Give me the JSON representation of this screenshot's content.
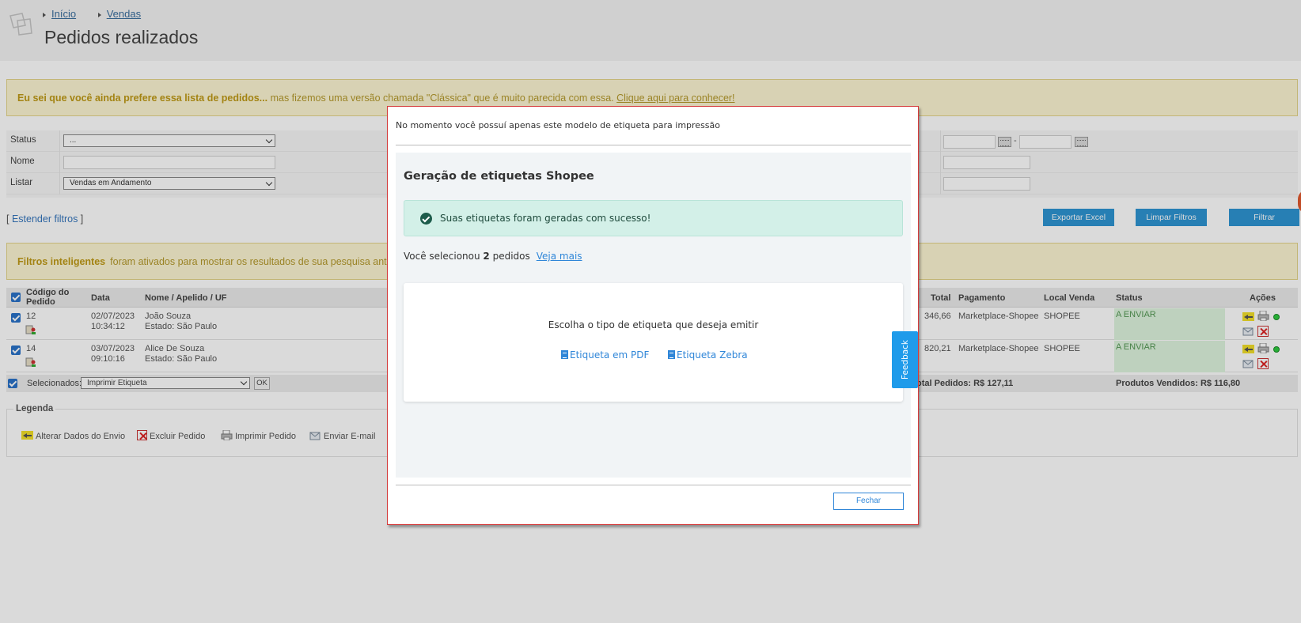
{
  "breadcrumb": [
    "Início",
    "Vendas"
  ],
  "page_title": "Pedidos realizados",
  "banner": {
    "bold": "Eu sei que você ainda prefere essa lista de pedidos...",
    "text": " mas fizemos uma versão chamada \"Clássica\" que é muito parecida com essa. ",
    "link": "Clique aqui para conhecer!"
  },
  "filters": {
    "status_label": "Status",
    "status_value": "...",
    "nome_label": "Nome",
    "listar_label": "Listar",
    "listar_value": "Vendas em Andamento",
    "date_separator": "-"
  },
  "extend_filters": {
    "open": "[ ",
    "link": "Estender filtros",
    "close": " ]"
  },
  "buttons": {
    "export": "Exportar Excel",
    "clear": "Limpar Filtros",
    "filter": "Filtrar"
  },
  "smart_filters": {
    "bold": "Filtros inteligentes",
    "text": "foram ativados para mostrar os resultados de sua pesquisa ant"
  },
  "table": {
    "headers": {
      "code": "Código do Pedido",
      "date": "Data",
      "name": "Nome / Apelido / UF",
      "total": "Total",
      "payment": "Pagamento",
      "local": "Local Venda",
      "status": "Status",
      "actions": "Ações"
    },
    "rows": [
      {
        "code": "12",
        "date": "02/07/2023",
        "time": "10:34:12",
        "name": "João Souza",
        "state": "Estado: São Paulo",
        "total": "346,66",
        "payment": "Marketplace-Shopee",
        "local": "SHOPEE",
        "status": "A ENVIAR"
      },
      {
        "code": "14",
        "date": "03/07/2023",
        "time": "09:10:16",
        "name": "Alice De Souza",
        "state": "Estado: São Paulo",
        "total": "820,21",
        "payment": "Marketplace-Shopee",
        "local": "SHOPEE",
        "status": "A ENVIAR"
      }
    ],
    "footer": {
      "selected_label": "Selecionados:",
      "action_value": "Imprimir Etiqueta",
      "ok": "OK",
      "total_pedidos": "otal Pedidos: R$ 127,11",
      "produtos_vendidos": "Produtos Vendidos: R$ 116,80"
    }
  },
  "legend": {
    "title": "Legenda",
    "items": [
      "Alterar Dados do Envio",
      "Excluir Pedido",
      "Imprimir Pedido",
      "Enviar E-mail"
    ]
  },
  "modal": {
    "top_text": "No momento você possuí apenas este modelo de etiqueta para impressão",
    "title": "Geração de etiquetas Shopee",
    "alert": "Suas etiquetas foram geradas com sucesso!",
    "selected_prefix": "Você selecionou ",
    "selected_count": "2",
    "selected_suffix": " pedidos",
    "see_more": "Veja mais",
    "choose": "Escolha o tipo de etiqueta que deseja emitir",
    "pdf": "Etiqueta em PDF",
    "zebra": "Etiqueta Zebra",
    "feedback": "Feedback",
    "close": "Fechar"
  },
  "colors": {
    "accent_blue": "#2e95d3",
    "success_bg": "#d3f0e8",
    "status_green_bg": "#dff5df",
    "modal_border": "#d43a3a",
    "banner_bg": "#fdf6d3"
  }
}
